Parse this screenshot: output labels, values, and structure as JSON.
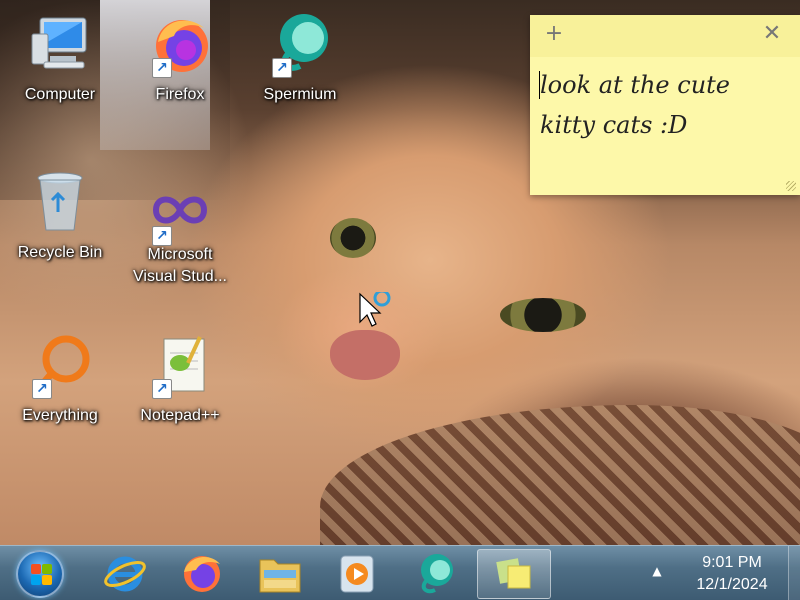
{
  "desktop_icons": [
    {
      "name": "computer",
      "label": "Computer"
    },
    {
      "name": "firefox",
      "label": "Firefox"
    },
    {
      "name": "spermium",
      "label": "Spermium"
    },
    {
      "name": "recycle-bin",
      "label": "Recycle Bin"
    },
    {
      "name": "visual-studio",
      "label": "Microsoft Visual Stud..."
    },
    {
      "name": "everything",
      "label": "Everything"
    },
    {
      "name": "notepadpp",
      "label": "Notepad++"
    }
  ],
  "sticky_note": {
    "text": "look at the cute kitty cats :D",
    "add_glyph": "+",
    "close_glyph": "✕"
  },
  "taskbar": {
    "items": [
      "start",
      "internet-explorer",
      "firefox",
      "file-explorer",
      "windows-media-player",
      "spermium",
      "sticky-notes"
    ],
    "active": "sticky-notes",
    "tray_arrow": "▲",
    "time": "9:01 PM",
    "date": "12/1/2024"
  },
  "colors": {
    "sticky_bg": "#fdf8a9",
    "taskbar": "#4f6f86",
    "accent": "#1f6cc7"
  }
}
